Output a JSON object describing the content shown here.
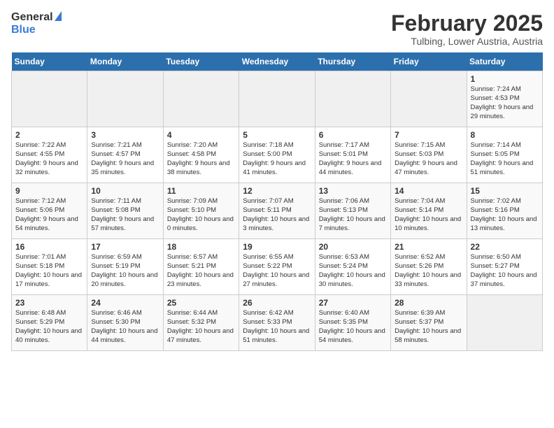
{
  "header": {
    "logo_general": "General",
    "logo_blue": "Blue",
    "calendar_title": "February 2025",
    "calendar_subtitle": "Tulbing, Lower Austria, Austria"
  },
  "weekdays": [
    "Sunday",
    "Monday",
    "Tuesday",
    "Wednesday",
    "Thursday",
    "Friday",
    "Saturday"
  ],
  "weeks": [
    [
      {
        "day": "",
        "info": ""
      },
      {
        "day": "",
        "info": ""
      },
      {
        "day": "",
        "info": ""
      },
      {
        "day": "",
        "info": ""
      },
      {
        "day": "",
        "info": ""
      },
      {
        "day": "",
        "info": ""
      },
      {
        "day": "1",
        "info": "Sunrise: 7:24 AM\nSunset: 4:53 PM\nDaylight: 9 hours and 29 minutes."
      }
    ],
    [
      {
        "day": "2",
        "info": "Sunrise: 7:22 AM\nSunset: 4:55 PM\nDaylight: 9 hours and 32 minutes."
      },
      {
        "day": "3",
        "info": "Sunrise: 7:21 AM\nSunset: 4:57 PM\nDaylight: 9 hours and 35 minutes."
      },
      {
        "day": "4",
        "info": "Sunrise: 7:20 AM\nSunset: 4:58 PM\nDaylight: 9 hours and 38 minutes."
      },
      {
        "day": "5",
        "info": "Sunrise: 7:18 AM\nSunset: 5:00 PM\nDaylight: 9 hours and 41 minutes."
      },
      {
        "day": "6",
        "info": "Sunrise: 7:17 AM\nSunset: 5:01 PM\nDaylight: 9 hours and 44 minutes."
      },
      {
        "day": "7",
        "info": "Sunrise: 7:15 AM\nSunset: 5:03 PM\nDaylight: 9 hours and 47 minutes."
      },
      {
        "day": "8",
        "info": "Sunrise: 7:14 AM\nSunset: 5:05 PM\nDaylight: 9 hours and 51 minutes."
      }
    ],
    [
      {
        "day": "9",
        "info": "Sunrise: 7:12 AM\nSunset: 5:06 PM\nDaylight: 9 hours and 54 minutes."
      },
      {
        "day": "10",
        "info": "Sunrise: 7:11 AM\nSunset: 5:08 PM\nDaylight: 9 hours and 57 minutes."
      },
      {
        "day": "11",
        "info": "Sunrise: 7:09 AM\nSunset: 5:10 PM\nDaylight: 10 hours and 0 minutes."
      },
      {
        "day": "12",
        "info": "Sunrise: 7:07 AM\nSunset: 5:11 PM\nDaylight: 10 hours and 3 minutes."
      },
      {
        "day": "13",
        "info": "Sunrise: 7:06 AM\nSunset: 5:13 PM\nDaylight: 10 hours and 7 minutes."
      },
      {
        "day": "14",
        "info": "Sunrise: 7:04 AM\nSunset: 5:14 PM\nDaylight: 10 hours and 10 minutes."
      },
      {
        "day": "15",
        "info": "Sunrise: 7:02 AM\nSunset: 5:16 PM\nDaylight: 10 hours and 13 minutes."
      }
    ],
    [
      {
        "day": "16",
        "info": "Sunrise: 7:01 AM\nSunset: 5:18 PM\nDaylight: 10 hours and 17 minutes."
      },
      {
        "day": "17",
        "info": "Sunrise: 6:59 AM\nSunset: 5:19 PM\nDaylight: 10 hours and 20 minutes."
      },
      {
        "day": "18",
        "info": "Sunrise: 6:57 AM\nSunset: 5:21 PM\nDaylight: 10 hours and 23 minutes."
      },
      {
        "day": "19",
        "info": "Sunrise: 6:55 AM\nSunset: 5:22 PM\nDaylight: 10 hours and 27 minutes."
      },
      {
        "day": "20",
        "info": "Sunrise: 6:53 AM\nSunset: 5:24 PM\nDaylight: 10 hours and 30 minutes."
      },
      {
        "day": "21",
        "info": "Sunrise: 6:52 AM\nSunset: 5:26 PM\nDaylight: 10 hours and 33 minutes."
      },
      {
        "day": "22",
        "info": "Sunrise: 6:50 AM\nSunset: 5:27 PM\nDaylight: 10 hours and 37 minutes."
      }
    ],
    [
      {
        "day": "23",
        "info": "Sunrise: 6:48 AM\nSunset: 5:29 PM\nDaylight: 10 hours and 40 minutes."
      },
      {
        "day": "24",
        "info": "Sunrise: 6:46 AM\nSunset: 5:30 PM\nDaylight: 10 hours and 44 minutes."
      },
      {
        "day": "25",
        "info": "Sunrise: 6:44 AM\nSunset: 5:32 PM\nDaylight: 10 hours and 47 minutes."
      },
      {
        "day": "26",
        "info": "Sunrise: 6:42 AM\nSunset: 5:33 PM\nDaylight: 10 hours and 51 minutes."
      },
      {
        "day": "27",
        "info": "Sunrise: 6:40 AM\nSunset: 5:35 PM\nDaylight: 10 hours and 54 minutes."
      },
      {
        "day": "28",
        "info": "Sunrise: 6:39 AM\nSunset: 5:37 PM\nDaylight: 10 hours and 58 minutes."
      },
      {
        "day": "",
        "info": ""
      }
    ]
  ]
}
